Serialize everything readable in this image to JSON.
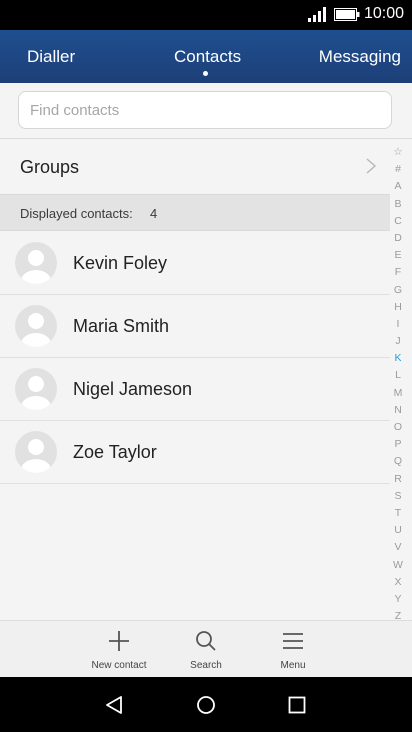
{
  "status_bar": {
    "time": "10:00"
  },
  "tabs": {
    "dialler": "Dialler",
    "contacts": "Contacts",
    "messaging": "Messaging"
  },
  "search": {
    "placeholder": "Find contacts"
  },
  "groups": {
    "label": "Groups"
  },
  "count_bar": {
    "label": "Displayed contacts:",
    "count": "4"
  },
  "contacts": [
    {
      "name": "Kevin Foley"
    },
    {
      "name": "Maria Smith"
    },
    {
      "name": "Nigel Jameson"
    },
    {
      "name": "Zoe Taylor"
    }
  ],
  "alphabet_index": [
    "☆",
    "#",
    "A",
    "B",
    "C",
    "D",
    "E",
    "F",
    "G",
    "H",
    "I",
    "J",
    "K",
    "L",
    "M",
    "N",
    "O",
    "P",
    "Q",
    "R",
    "S",
    "T",
    "U",
    "V",
    "W",
    "X",
    "Y",
    "Z"
  ],
  "alphabet_active": "K",
  "bottom_actions": {
    "new_contact": "New contact",
    "search": "Search",
    "menu": "Menu"
  },
  "colors": {
    "header": "#1f4f8f",
    "index_active": "#2a9ed6"
  }
}
